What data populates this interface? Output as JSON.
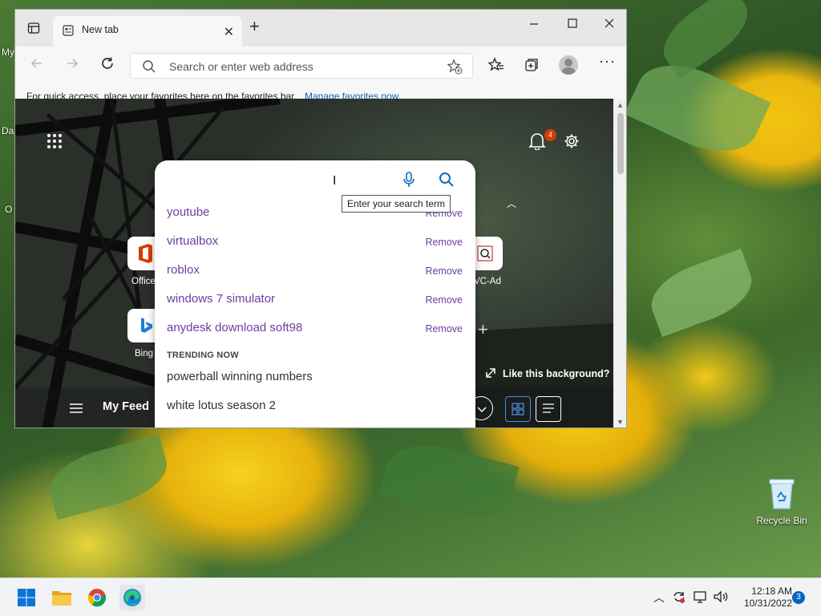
{
  "desktop": {
    "clipped_labels": [
      "My",
      "Da",
      "O"
    ],
    "recycle_bin_label": "Recycle Bin"
  },
  "browser": {
    "tab": {
      "title": "New tab"
    },
    "address": {
      "placeholder": "Search or enter web address"
    },
    "favorites_bar": {
      "message": "For quick access, place your favorites here on the favorites bar.",
      "link": "Manage favorites now"
    }
  },
  "newtab_page": {
    "notification_count": "4",
    "quick_links": [
      "Office",
      "VC-Ad",
      "Bing"
    ],
    "like_background": "Like this background?",
    "feed_label": "My Feed",
    "search": {
      "tooltip": "Enter your search term",
      "recent": [
        {
          "text": "youtube",
          "remove": "Remove"
        },
        {
          "text": "virtualbox",
          "remove": "Remove"
        },
        {
          "text": "roblox",
          "remove": "Remove"
        },
        {
          "text": "windows 7 simulator",
          "remove": "Remove"
        },
        {
          "text": "anydesk download soft98",
          "remove": "Remove"
        }
      ],
      "trending_heading": "TRENDING NOW",
      "trending": [
        "powerball winning numbers",
        "white lotus season 2"
      ]
    }
  },
  "taskbar": {
    "time": "12:18 AM",
    "date": "10/31/2022",
    "notification_count": "3"
  },
  "colors": {
    "accent": "#0067c0",
    "suggestion_text": "#6b3fa0",
    "badge": "#d83b01"
  }
}
